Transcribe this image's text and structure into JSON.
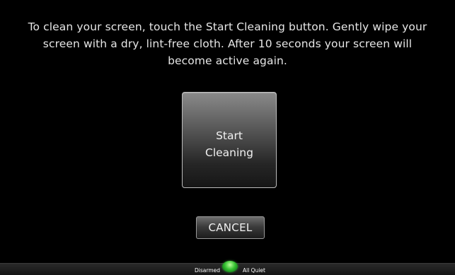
{
  "instructions": {
    "line1": "To clean your screen, touch the Start Cleaning button.  Gently wipe your",
    "line2": "screen with a dry, lint-free cloth. After 10 seconds your screen will",
    "line3": "become active again."
  },
  "start_button": {
    "line1": "Start",
    "line2": "Cleaning"
  },
  "cancel_button": {
    "label": "CANCEL"
  },
  "status_bar": {
    "left_text": "Disarmed",
    "right_text": "All Quiet",
    "indicator_icon": "green-status-light-icon",
    "indicator_color": "#37c232"
  }
}
